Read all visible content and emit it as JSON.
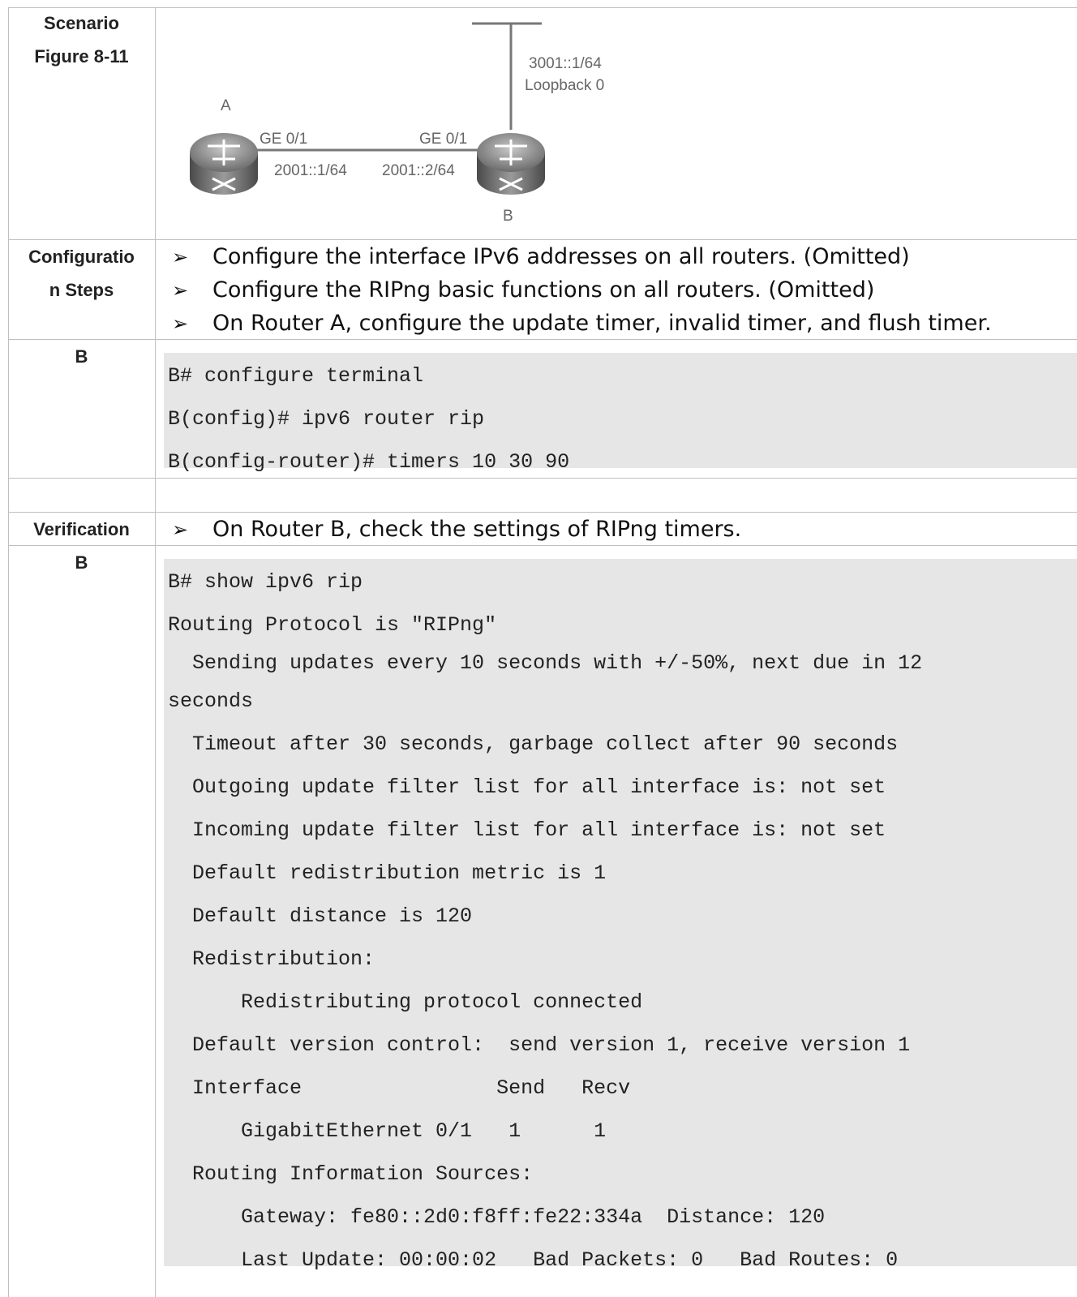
{
  "scenario": {
    "label_line1": "Scenario",
    "label_line2": "Figure 8-11",
    "diagram": {
      "router_a_label": "A",
      "router_b_label": "B",
      "a_interface": "GE 0/1",
      "b_interface": "GE 0/1",
      "a_address": "2001::1/64",
      "b_address": "2001::2/64",
      "loopback_address": "3001::1/64",
      "loopback_name": "Loopback 0"
    }
  },
  "config_steps": {
    "label_line1": "Configuratio",
    "label_line2": "n Steps",
    "bullet_symbol": "➢",
    "items": [
      "Configure the interface IPv6 addresses on all routers. (Omitted)",
      "Configure the RIPng basic functions on all routers. (Omitted)",
      "On Router A, configure the update timer, invalid timer, and flush timer."
    ]
  },
  "config_code": {
    "label": "B",
    "lines": [
      "B# configure terminal",
      "B(config)# ipv6 router rip",
      "B(config-router)# timers 10 30 90"
    ]
  },
  "verification": {
    "label": "Verification",
    "bullet_symbol": "➢",
    "item": "On Router B, check the settings of RIPng timers."
  },
  "verify_code": {
    "label": "B",
    "lines": [
      "B# show ipv6 rip",
      "Routing Protocol is \"RIPng\"",
      "  Sending updates every 10 seconds with +/-50%, next due in 12",
      "seconds",
      "  Timeout after 30 seconds, garbage collect after 90 seconds",
      "  Outgoing update filter list for all interface is: not set",
      "  Incoming update filter list for all interface is: not set",
      "  Default redistribution metric is 1",
      "  Default distance is 120",
      "  Redistribution:",
      "      Redistributing protocol connected",
      "  Default version control:  send version 1, receive version 1",
      "  Interface                Send   Recv",
      "      GigabitEthernet 0/1   1      1",
      "  Routing Information Sources:",
      "      Gateway: fe80::2d0:f8ff:fe22:334a  Distance: 120",
      "      Last Update: 00:00:02   Bad Packets: 0   Bad Routes: 0"
    ]
  }
}
